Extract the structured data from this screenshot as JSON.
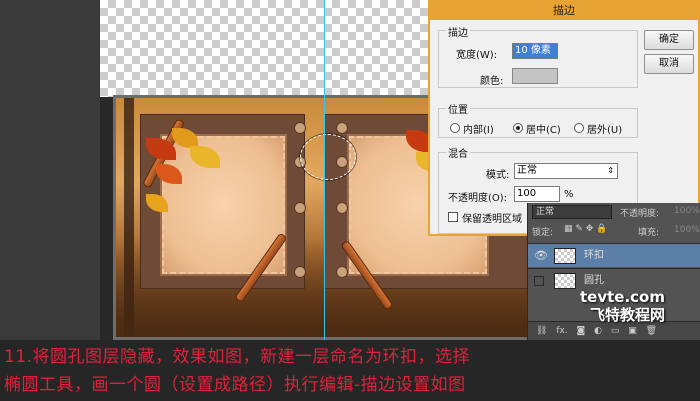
{
  "dialog": {
    "title": "描边",
    "stroke_group": "描边",
    "width_label": "宽度(W):",
    "width_value": "10 像素",
    "color_label": "颜色:",
    "position_group": "位置",
    "position_options": [
      "内部(I)",
      "居中(C)",
      "居外(U)"
    ],
    "position_selected": "居中(C)",
    "blend_group": "混合",
    "mode_label": "模式:",
    "mode_value": "正常",
    "opacity_label": "不透明度(O):",
    "opacity_value": "100",
    "opacity_unit": "%",
    "preserve_label": "保留透明区域",
    "ok_label": "确定",
    "cancel_label": "取消"
  },
  "layers_panel": {
    "blend_mode": "正常",
    "opacity_label": "不透明度:",
    "opacity_value": "100%",
    "lock_label": "锁定:",
    "fill_label": "填充:",
    "fill_value": "100%",
    "layers": [
      {
        "name": "环扣",
        "visible": true,
        "selected": true
      },
      {
        "name": "圆孔",
        "visible": false,
        "selected": false
      }
    ],
    "footer_icons": [
      "link-icon",
      "fx-icon",
      "mask-icon",
      "adjustment-icon",
      "folder-icon",
      "new-layer-icon",
      "trash-icon"
    ]
  },
  "watermark": {
    "line1": "tevte.com",
    "line2": "飞特教程网"
  },
  "caption": {
    "line1": "11.将圆孔图层隐藏，效果如图，新建一层命名为环扣，选择",
    "line2": "椭圆工具，画一个圆（设置成路径）执行编辑-描边设置如图"
  },
  "colors": {
    "dialog_accent": "#e8a432",
    "guide": "#2fc6f0",
    "caption_text": "#e0213a",
    "selected_layer": "#5b7fa6"
  }
}
